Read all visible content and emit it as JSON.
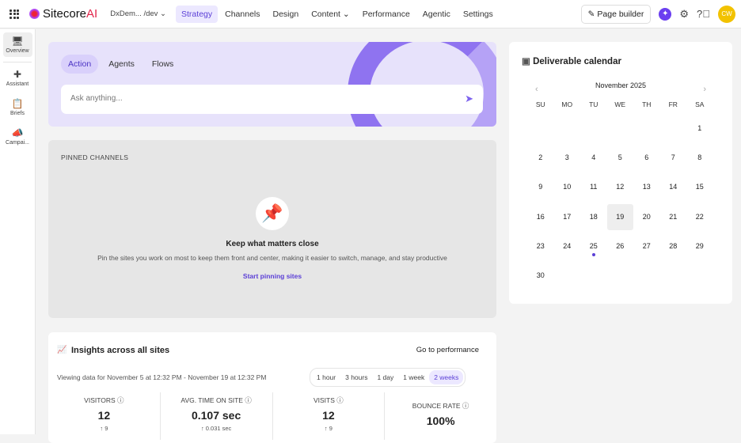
{
  "header": {
    "brand": "Sitecore",
    "brand_ai": "AI",
    "env": "DxDem... /dev ⌄",
    "nav": [
      "Strategy",
      "Channels",
      "Design",
      "Content ⌄",
      "Performance",
      "Agentic",
      "Settings"
    ],
    "active_nav": 0,
    "page_builder": "Page builder",
    "avatar": "CW"
  },
  "sidebar": {
    "items": [
      {
        "label": "Overview",
        "icon": "monitor-icon"
      },
      {
        "label": "Assistant",
        "icon": "assistant-icon"
      },
      {
        "label": "Briefs",
        "icon": "clipboard-icon"
      },
      {
        "label": "Campai...",
        "icon": "megaphone-icon"
      }
    ]
  },
  "hero": {
    "tabs": [
      "Action",
      "Agents",
      "Flows"
    ],
    "active_tab": 0,
    "placeholder": "Ask anything..."
  },
  "pinned": {
    "heading": "PINNED CHANNELS",
    "title": "Keep what matters close",
    "description": "Pin the sites you work on most to keep them front and center, making it easier to switch, manage, and stay productive",
    "link": "Start pinning sites"
  },
  "calendar": {
    "title": "Deliverable calendar",
    "month": "November 2025",
    "weekdays": [
      "SU",
      "MO",
      "TU",
      "WE",
      "TH",
      "FR",
      "SA"
    ],
    "first_weekday": 6,
    "days": 30,
    "selected": 19,
    "marked": [
      25
    ]
  },
  "insights": {
    "title": "Insights across all sites",
    "go": "Go to performance",
    "viewing": "Viewing data for November 5 at 12:32 PM - November 19 at 12:32 PM",
    "ranges": [
      "1 hour",
      "3 hours",
      "1 day",
      "1 week",
      "2 weeks"
    ],
    "active_range": 4,
    "metrics": [
      {
        "label": "VISITORS ⓘ",
        "value": "12",
        "change": "↑ 9"
      },
      {
        "label": "AVG. TIME ON SITE ⓘ",
        "value": "0.107 sec",
        "change": "↑ 0.031 sec"
      },
      {
        "label": "VISITS ⓘ",
        "value": "12",
        "change": "↑ 9"
      },
      {
        "label": "BOUNCE RATE ⓘ",
        "value": "100%",
        "change": ""
      }
    ]
  },
  "colors": {
    "accent": "#5b3fd6",
    "avatar": "#f2c200"
  }
}
